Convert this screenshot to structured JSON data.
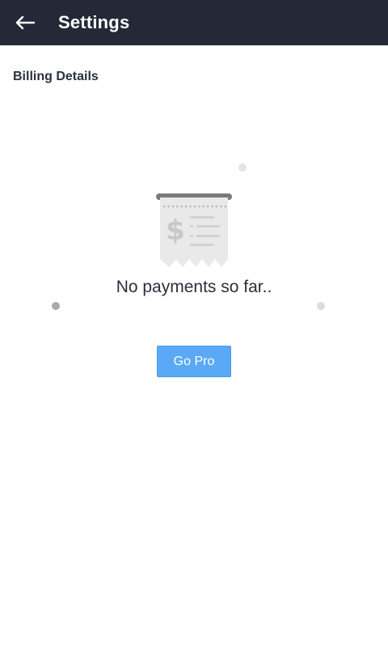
{
  "app": {
    "title": "Settings",
    "back_icon": "arrow-left-icon"
  },
  "section": {
    "title": "Billing Details"
  },
  "empty_state": {
    "icon": "receipt-icon",
    "message": "No payments so far.."
  },
  "actions": {
    "go_pro_label": "Go Pro"
  },
  "colors": {
    "topbar": "#232936",
    "accent": "#5aa9f7",
    "text": "#2a2f3a"
  }
}
